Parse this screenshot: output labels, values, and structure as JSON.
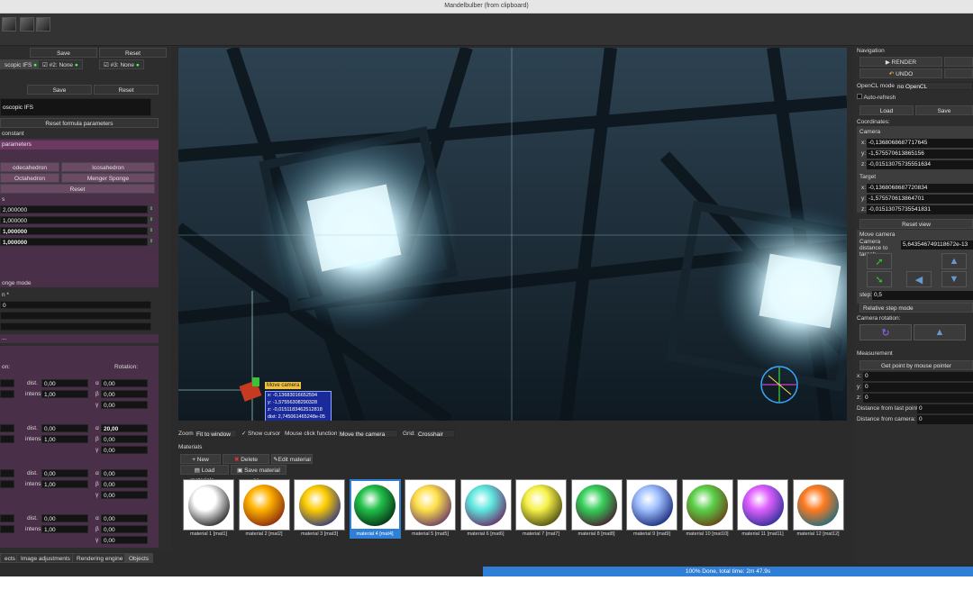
{
  "window": {
    "title": "Mandelbulber (from clipboard)"
  },
  "left": {
    "save1": "Save",
    "reset1": "Reset",
    "formula_tabs": [
      "scopic IFS",
      "#2: None",
      "#3: None"
    ],
    "save2": "Save",
    "reset2": "Reset",
    "formula_name": "oscopic IFS",
    "reset_formula": "Reset formula parameters",
    "constant_label": "constant",
    "params_header": "parameters",
    "shape_buttons": [
      "odecahedron",
      "Icosahedron",
      "Octahedron",
      "Menger Sponge"
    ],
    "reset3": "Reset",
    "section2_label": "s",
    "values": [
      "2,000000",
      "1,000000",
      "1,000000",
      "1,000000"
    ],
    "sponge_mode": "onge mode",
    "section3_label": "n *",
    "section3_value": "0",
    "section4_label": "...",
    "position_label": "on:",
    "rotation_label": "Rotation:",
    "dist_label": "dist.",
    "intens_label": "intens.",
    "light_rows": [
      {
        "dist": "0,00",
        "intens": "1,00",
        "a": "0,00",
        "b": "0,00",
        "y": "0,00"
      },
      {
        "dist": "0,00",
        "intens": "1,00",
        "a": "20,00",
        "b": "0,00",
        "y": "0,00"
      },
      {
        "dist": "0,00",
        "intens": "1,00",
        "a": "0,00",
        "b": "0,00",
        "y": "0,00"
      },
      {
        "dist": "0,00",
        "intens": "1,00",
        "a": "0,00",
        "b": "0,00",
        "y": "0,00"
      }
    ],
    "greek": {
      "a": "α",
      "b": "β",
      "y": "γ"
    },
    "tabs": [
      "ects",
      "Image adjustments",
      "Rendering engine",
      "Objects"
    ]
  },
  "viewport": {
    "tooltip_title": "Move camera",
    "tooltip_lines": [
      "x: -0,13683016652594",
      "y: -1,57556308290328",
      "z: -0,0151183462512818",
      "dist: 2,745061465248e-05"
    ]
  },
  "zoombar": {
    "zoom_label": "Zoom:",
    "zoom_value": "Fit to window",
    "show_cursor": "Show cursor",
    "mouse_label": "Mouse click function:",
    "mouse_value": "Move the camera",
    "grid_label": "Grid:",
    "grid_value": "Crosshair"
  },
  "materials": {
    "title": "Materials",
    "new": "New material",
    "delete": "Delete material",
    "edit": "Edit material",
    "load": "Load materials...",
    "save": "Save material as...",
    "items": [
      {
        "name": "material 1 [mat1]",
        "c1": "#ffffff",
        "c2": "#111111"
      },
      {
        "name": "material 2 [mat2]",
        "c1": "#ffb300",
        "c2": "#7a1a10"
      },
      {
        "name": "material 3 [mat3]",
        "c1": "#ffcc00",
        "c2": "#1a2a8a"
      },
      {
        "name": "material 4 [mat4]",
        "c1": "#22c14a",
        "c2": "#03200c"
      },
      {
        "name": "material 5 [mat5]",
        "c1": "#ffe04a",
        "c2": "#5a2a6a"
      },
      {
        "name": "material 6 [mat6]",
        "c1": "#5ee8e0",
        "c2": "#6a1a5a"
      },
      {
        "name": "material 7 [mat7]",
        "c1": "#f7f24a",
        "c2": "#3a3a0a"
      },
      {
        "name": "material 8 [mat8]",
        "c1": "#35d05a",
        "c2": "#4a0a2a"
      },
      {
        "name": "material 9 [mat9]",
        "c1": "#a0c0ff",
        "c2": "#0a1a6a"
      },
      {
        "name": "material 10 [mat10]",
        "c1": "#5ad04a",
        "c2": "#6a3010"
      },
      {
        "name": "material 11 [mat11]",
        "c1": "#e060ff",
        "c2": "#1a2a8a"
      },
      {
        "name": "material 12 [mat12]",
        "c1": "#ff7a20",
        "c2": "#0a6a8a"
      }
    ],
    "selected_index": 3
  },
  "status": {
    "progress_text": "100% Done, total time: 2m 47.9s",
    "progress": 1.0
  },
  "right": {
    "navigation": "Navigation",
    "render": "RENDER",
    "undo": "UNDO",
    "opencl_label": "OpenCL mode:",
    "opencl_value": "no OpenCL",
    "auto_refresh": "Auto-refresh",
    "load": "Load",
    "save": "Save",
    "coordinates": "Coordinates:",
    "camera": "Camera",
    "camera_xyz": [
      "-0,1368068687717645",
      "-1,575570613865156",
      "-0,01513075735551634"
    ],
    "target": "Target",
    "target_xyz": [
      "-0,1368068687720834",
      "-1,575570613864701",
      "-0,01513075735541831"
    ],
    "axis": [
      "x:",
      "y:",
      "z:"
    ],
    "reset_view": "Reset view",
    "move_camera": "Move camera",
    "cam_dist_label": "Camera distance to target:",
    "cam_dist_value": "5,643546749118672e-13",
    "step_label": "step:",
    "step_value": "0,5",
    "relative_step": "Relative step mode",
    "camera_rotation": "Camera rotation:",
    "measurement": "Measurement",
    "get_point": "Get point by mouse pointer",
    "meas_xyz": [
      "0",
      "0",
      "0"
    ],
    "dist_last_label": "Distance from last point:",
    "dist_last_value": "0",
    "dist_cam_label": "Distance from camera:",
    "dist_cam_value": "0"
  }
}
